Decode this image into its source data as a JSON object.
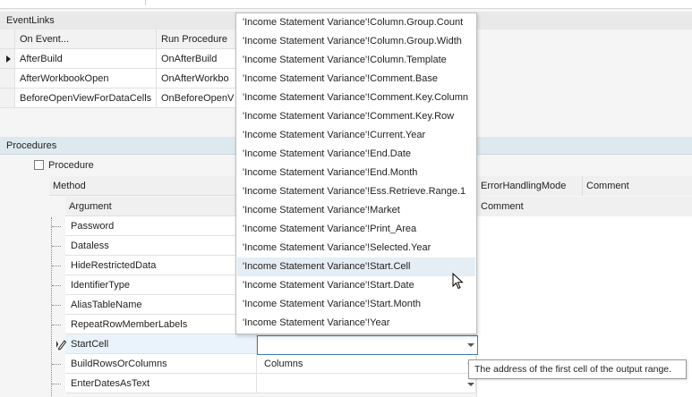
{
  "event_links": {
    "title": "EventLinks",
    "columns": [
      "On Event...",
      "Run Procedure"
    ],
    "rows": [
      {
        "event": "AfterBuild",
        "procedure": "OnAfterBuild",
        "current": true
      },
      {
        "event": "AfterWorkbookOpen",
        "procedure": "OnAfterWorkbo"
      },
      {
        "event": "BeforeOpenViewForDataCells",
        "procedure": "OnBeforeOpenV"
      }
    ]
  },
  "procedures": {
    "title": "Procedures",
    "procedure_label": "Procedure",
    "method_header": "Method",
    "argument_header": "Argument",
    "right_headers": {
      "error_handling": "ErrorHandlingMode",
      "comment": "Comment",
      "arg_comment": "Comment"
    },
    "arguments": [
      {
        "name": "Password",
        "value": ""
      },
      {
        "name": "Dataless",
        "value": ""
      },
      {
        "name": "HideRestrictedData",
        "value": ""
      },
      {
        "name": "IdentifierType",
        "value": ""
      },
      {
        "name": "AliasTableName",
        "value": ""
      },
      {
        "name": "RepeatRowMemberLabels",
        "value": ""
      },
      {
        "name": "StartCell",
        "value": ""
      },
      {
        "name": "BuildRowsOrColumns",
        "value": "Columns"
      },
      {
        "name": "EnterDatesAsText",
        "value": ""
      }
    ]
  },
  "dropdown": {
    "items": [
      "'Income Statement Variance'!Column.Group.Count",
      "'Income Statement Variance'!Column.Group.Width",
      "'Income Statement Variance'!Column.Template",
      "'Income Statement Variance'!Comment.Base",
      "'Income Statement Variance'!Comment.Key.Column",
      "'Income Statement Variance'!Comment.Key.Row",
      "'Income Statement Variance'!Current.Year",
      "'Income Statement Variance'!End.Date",
      "'Income Statement Variance'!End.Month",
      "'Income Statement Variance'!Ess.Retrieve.Range.1",
      "'Income Statement Variance'!Market",
      "'Income Statement Variance'!Print_Area",
      "'Income Statement Variance'!Selected.Year",
      "'Income Statement Variance'!Start.Cell",
      "'Income Statement Variance'!Start.Date",
      "'Income Statement Variance'!Start.Month",
      "'Income Statement Variance'!Year"
    ],
    "hovered_index": 13
  },
  "tooltip": {
    "text": "The address of the first cell of the output range."
  }
}
